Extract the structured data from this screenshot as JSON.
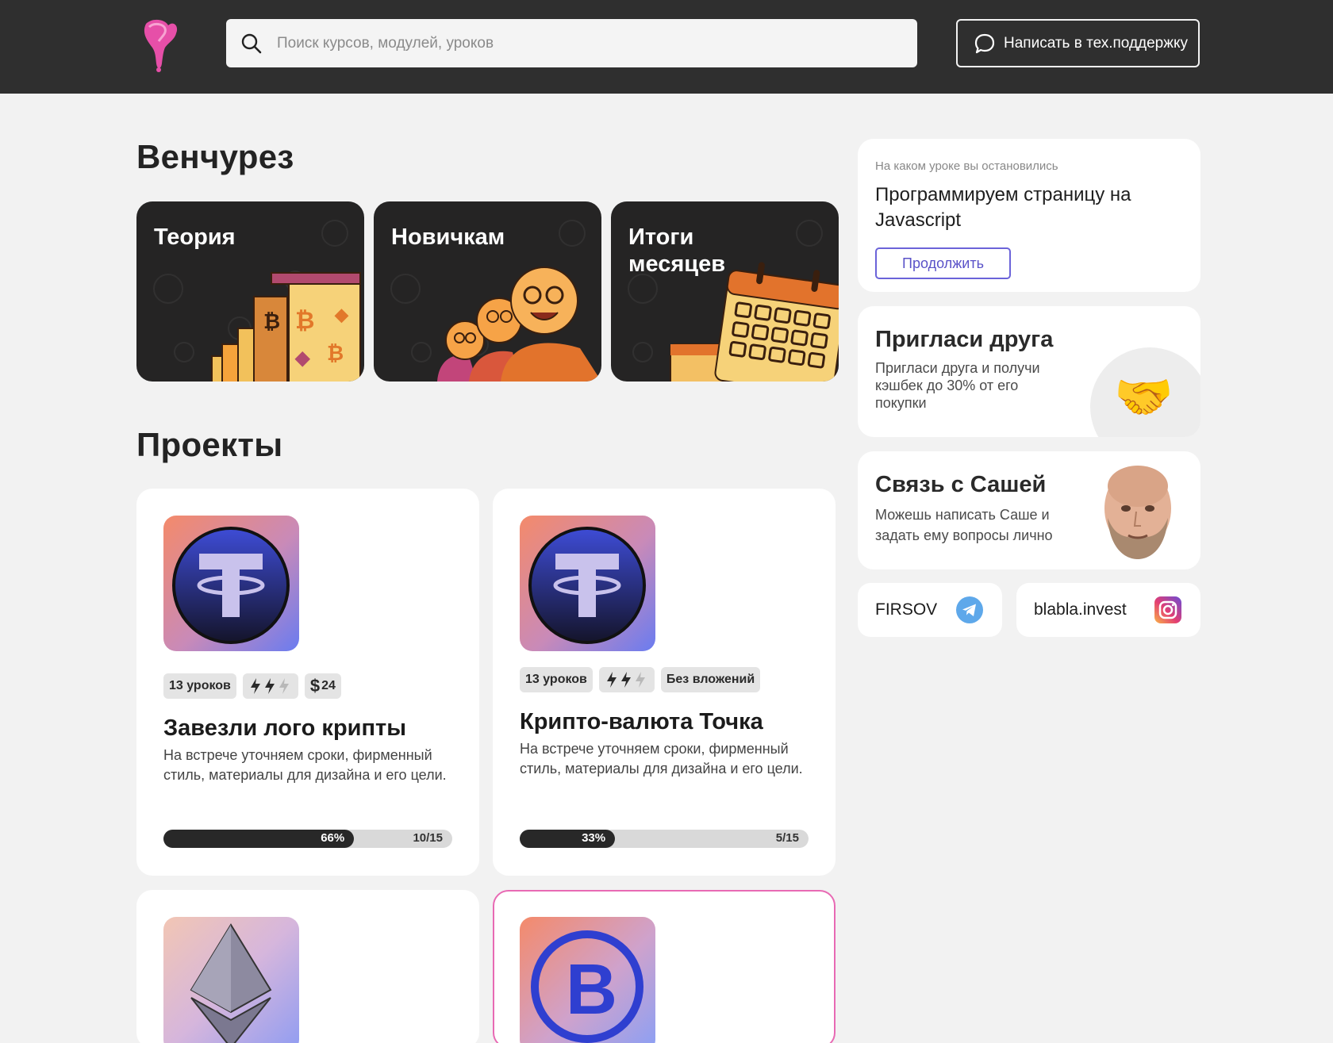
{
  "header": {
    "search_placeholder": "Поиск курсов, модулей, уроков",
    "support_label": "Написать в тех.поддержку"
  },
  "sections": {
    "venture_title": "Венчурез",
    "projects_title": "Проекты"
  },
  "categories": [
    {
      "label": "Теория"
    },
    {
      "label": "Новичкам"
    },
    {
      "label": "Итоги месяцев"
    }
  ],
  "resume": {
    "label": "На каком уроке вы остановились",
    "title": "Программируем страницу на Javascript",
    "button": "Продолжить"
  },
  "invite": {
    "title": "Пригласи друга",
    "text": "Пригласи друга и получи кэшбек до 30% от его покупки",
    "emoji": "🤝"
  },
  "contact": {
    "title": "Связь с Сашей",
    "text": "Можешь написать Саше и задать ему вопросы лично"
  },
  "socials": [
    {
      "label": "FIRSOV",
      "icon": "telegram-icon"
    },
    {
      "label": "blabla.invest",
      "icon": "instagram-icon"
    }
  ],
  "projects": [
    {
      "lessons": "13 уроков",
      "price": "24",
      "title": "Завезли лого крипты",
      "desc": "На встрече уточняем сроки, фирменный стиль, материалы для дизайна и его цели.",
      "progress_label": "66%",
      "progress": 0.66,
      "count": "10/15"
    },
    {
      "lessons": "13 уроков",
      "extra": "Без вложений",
      "title": "Крипто-валюта Точка",
      "desc": "На встрече уточняем сроки, фирменный стиль, материалы для дизайна и его цели.",
      "progress_label": "33%",
      "progress": 0.33,
      "count": "5/15"
    }
  ],
  "colors": {
    "topbar": "#2f2f2f",
    "accent_purple": "#6b63d9",
    "accent_pink": "#e86ab4",
    "card_dark": "#252424",
    "orange": "#f5a33b"
  }
}
